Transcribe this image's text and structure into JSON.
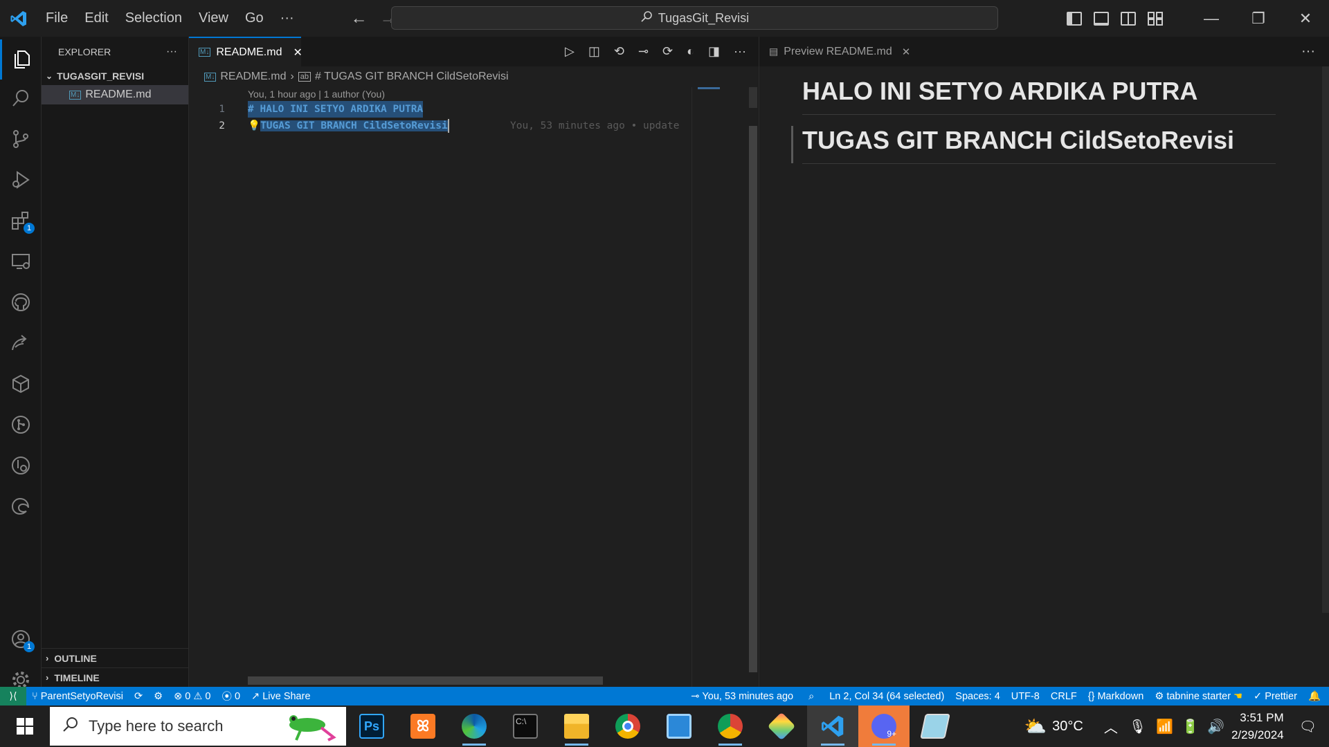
{
  "titlebar": {
    "menu": [
      "File",
      "Edit",
      "Selection",
      "View",
      "Go",
      "···"
    ],
    "search_text": "TugasGit_Revisi"
  },
  "activity": {
    "extensions_badge": "1",
    "accounts_badge": "1"
  },
  "sidebar": {
    "title": "EXPLORER",
    "more": "···",
    "folder": "TUGASGIT_REVISI",
    "file": "README.md",
    "outline": "OUTLINE",
    "timeline": "TIMELINE"
  },
  "editor": {
    "tab_label": "README.md",
    "breadcrumb_file": "README.md",
    "breadcrumb_symbol": "# TUGAS GIT BRANCH CildSetoRevisi",
    "blame": "You, 1 hour ago | 1 author (You)",
    "lines": [
      {
        "num": "1",
        "text": "# HALO INI SETYO ARDIKA PUTRA"
      },
      {
        "num": "2",
        "text": "TUGAS GIT BRANCH CildSetoRevisi"
      }
    ],
    "ghost_blame": "You, 53 minutes ago • update"
  },
  "preview": {
    "tab_label": "Preview README.md",
    "heading1": "HALO INI SETYO ARDIKA PUTRA",
    "heading2": "TUGAS GIT BRANCH CildSetoRevisi"
  },
  "statusbar": {
    "branch": "ParentSetyoRevisi",
    "errors": "0",
    "warnings": "0",
    "ports": "0",
    "live_share": "Live Share",
    "git_blame": "You, 53 minutes ago",
    "position": "Ln 2, Col 34 (64 selected)",
    "spaces": "Spaces: 4",
    "encoding": "UTF-8",
    "eol": "CRLF",
    "language": "Markdown",
    "tabnine": "tabnine starter",
    "prettier": "Prettier"
  },
  "taskbar": {
    "search_placeholder": "Type here to search",
    "weather": "30°C",
    "time": "3:51 PM",
    "date": "2/29/2024"
  },
  "colors": {
    "accent": "#0078d4",
    "selection": "#264f78",
    "heading_token": "#569cd6"
  }
}
